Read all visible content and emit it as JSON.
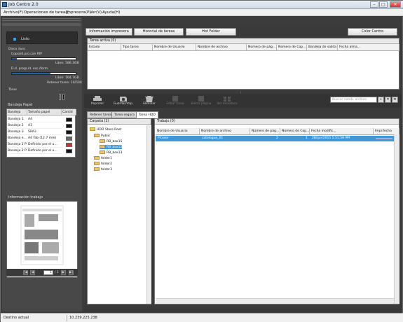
{
  "window": {
    "title": "Job Centro 2.0",
    "min": "–",
    "max": "□",
    "close": "✕"
  },
  "menu": [
    "Archivo(F)",
    "Operaciones de tarea(J)",
    "Impresora(P)",
    "Ver(V)",
    "Ayuda(H)"
  ],
  "left": {
    "status": "Listo",
    "disk": {
      "title": "Disco duro",
      "copy_label": "Copia/d.pro.con RIP",
      "copy_free": "Libre: 586.3GB",
      "copy_fill": 0.08,
      "saved_label": "D.d. progr./d. esc./form.",
      "saved_free": "Libre: 164.7GB",
      "saved_fill": 0.6,
      "hold": "Retener tarea: 10/500"
    },
    "toner": "Tóner",
    "tray": {
      "title": "Bandeja Papel",
      "headers": [
        "Bandeja",
        "Tamaño papel",
        "Cantid"
      ],
      "rows": [
        [
          "Bandeja 1",
          "A4"
        ],
        [
          "Bandeja 2",
          "A3"
        ],
        [
          "Bandeja 3",
          "SRA3"
        ],
        [
          "Bandeja e...",
          "A4 Tab (12.7 mm)"
        ],
        [
          "Bandeja 1 P1",
          "Definido por el u..."
        ],
        [
          "Bandeja 2 P1",
          "Definido por el u..."
        ]
      ]
    },
    "jobinfo": "Información trabajo",
    "pager": {
      "first": "|◀",
      "prev": "◀",
      "page": "1",
      "next": "▶",
      "last": "▶|",
      "total": "/ 1"
    }
  },
  "top_buttons": [
    "Información impresora",
    "Historial de tareas",
    "Hot Folder",
    "Color Centro"
  ],
  "active_jobs": {
    "title": "Tarea activa (0)",
    "columns": [
      "Estado",
      "Tipo tarea",
      "Nombre de Usuario",
      "Nombre de archivo",
      "Número de pág...",
      "Número de Cop...",
      "Bandeja de salida",
      "Fecha alma..."
    ]
  },
  "toolbar": {
    "buttons": [
      {
        "label": "Imprimir",
        "enabled": true
      },
      {
        "label": "Guardar/imp.",
        "enabled": true
      },
      {
        "label": "Eliminar",
        "enabled": true
      },
      {
        "label": "Editar tarea",
        "enabled": false
      },
      {
        "label": "Editar página",
        "enabled": false
      },
      {
        "label": "Ver miniatura",
        "enabled": false
      }
    ],
    "search_placeholder": "Buscar nomb. archivo",
    "search_icon": "⌕",
    "clear_icon": "✕",
    "menu_icon": "≡"
  },
  "tabs": [
    "Retener tarea",
    "Tarea segura",
    "Tarea HDD"
  ],
  "folders": {
    "title": "Carpeta (2)",
    "root": "HDD Store Root",
    "public": "Public",
    "boxes": [
      "RB_box15",
      "RB_box12",
      "RB_box13"
    ],
    "others": [
      "folder1",
      "folder2",
      "folder3"
    ]
  },
  "jobs": {
    "title": "Trabajo (0)",
    "columns": [
      "Nombre de Usuario",
      "Nombre de archivo",
      "Número de pág...",
      "Número de Cop...",
      "Fecha modific...",
      "Impr.fecha"
    ],
    "rows": [
      {
        "user": "PCuser",
        "file": "catalogue_01",
        "pages": "2",
        "copies": "1",
        "date": "28/Jun/2015 5:51:58 PM"
      }
    ]
  },
  "statusbar": {
    "dest": "Destino actual",
    "ip": "10.239.225.238"
  },
  "colors": {
    "accent": "#2b5ea8",
    "selection": "#3d97d8",
    "dark_panel": "#484848"
  }
}
